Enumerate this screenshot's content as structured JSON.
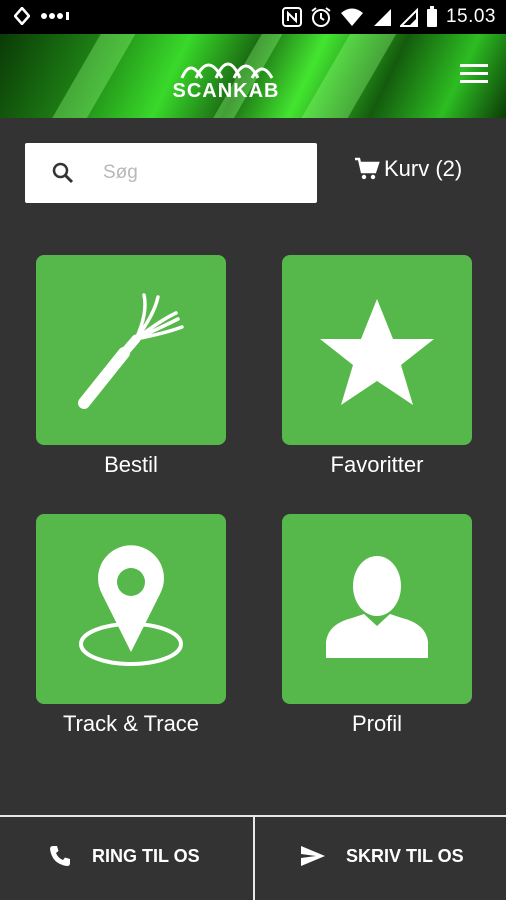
{
  "status_bar": {
    "time": "15.03"
  },
  "header": {
    "logo_text": "SCANKAB"
  },
  "search": {
    "placeholder": "Søg",
    "value": ""
  },
  "cart": {
    "label": "Kurv (2)"
  },
  "tiles": [
    {
      "label": "Bestil",
      "icon": "cable-icon"
    },
    {
      "label": "Favoritter",
      "icon": "star-icon"
    },
    {
      "label": "Track & Trace",
      "icon": "location-pin-icon"
    },
    {
      "label": "Profil",
      "icon": "person-icon"
    }
  ],
  "bottom": {
    "call_label": "RING TIL OS",
    "write_label": "SKRIV TIL OS"
  },
  "colors": {
    "tile_green": "#56b84a",
    "background": "#333333",
    "status_bar": "#000000"
  }
}
